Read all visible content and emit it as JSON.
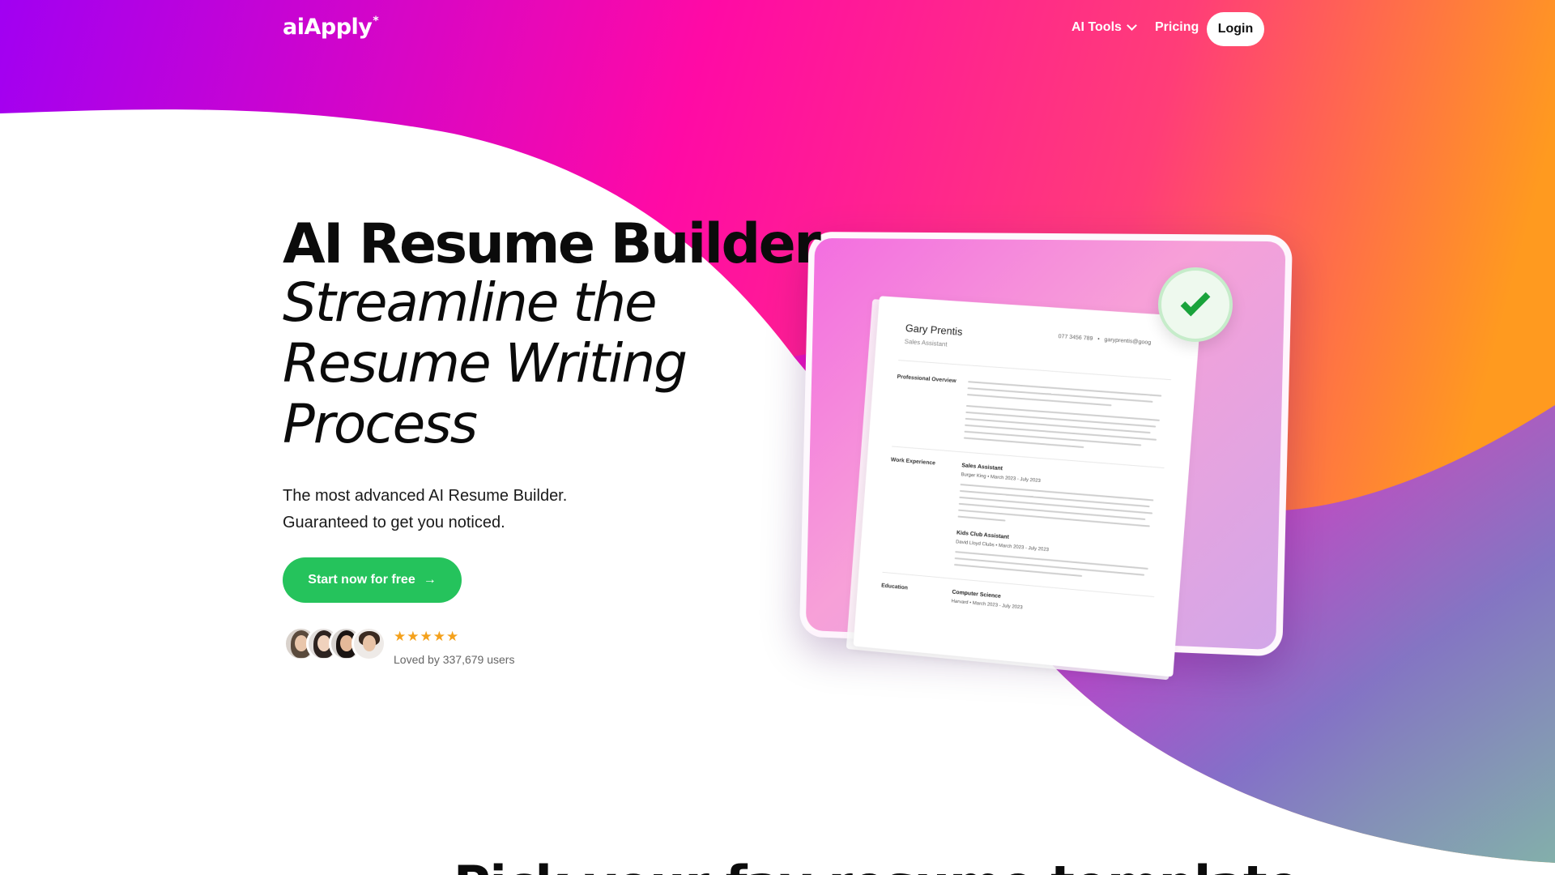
{
  "nav": {
    "logo": "aiApply",
    "logo_star": "*",
    "ai_tools_label": "AI Tools",
    "pricing_label": "Pricing",
    "login_label": "Login"
  },
  "hero": {
    "title": "AI Resume Builder",
    "subtitle": "Streamline the Resume Writing Process",
    "description_line1": "The most advanced AI Resume Builder.",
    "description_line2": "Guaranteed to get you noticed.",
    "cta_label": "Start now for free",
    "cta_arrow": "→",
    "stars": "★★★★★",
    "rating": 5,
    "loved_text": "Loved by 337,679 users"
  },
  "resume_preview": {
    "name": "Gary Prentis",
    "role": "Sales Assistant",
    "phone": "077 3456 789",
    "email": "garyprentis@goog",
    "sections": {
      "overview": "Professional Overview",
      "experience": "Work Experience",
      "education": "Education"
    },
    "jobs": [
      {
        "title": "Sales Assistant",
        "meta": "Burger King  •  March 2023 - July 2023"
      },
      {
        "title": "Kids Club Assistant",
        "meta": "David Lloyd Clubs  •  March 2023 - July 2023"
      }
    ],
    "education": {
      "title": "Computer Science",
      "meta": "Harvard  •  March 2023 - July 2023"
    }
  },
  "bottom": {
    "heading_partial": "Pick your fav resume template"
  },
  "colors": {
    "cta_green": "#25c35c",
    "gradient_purple": "#a100f2",
    "gradient_pink": "#ff0aa5",
    "gradient_orange": "#ff9a1f",
    "star_orange": "#f4a11c",
    "check_green": "#19a33b"
  },
  "icons": [
    "chevron-down-icon",
    "arrow-right-icon",
    "checkmark-icon",
    "star-icon"
  ]
}
